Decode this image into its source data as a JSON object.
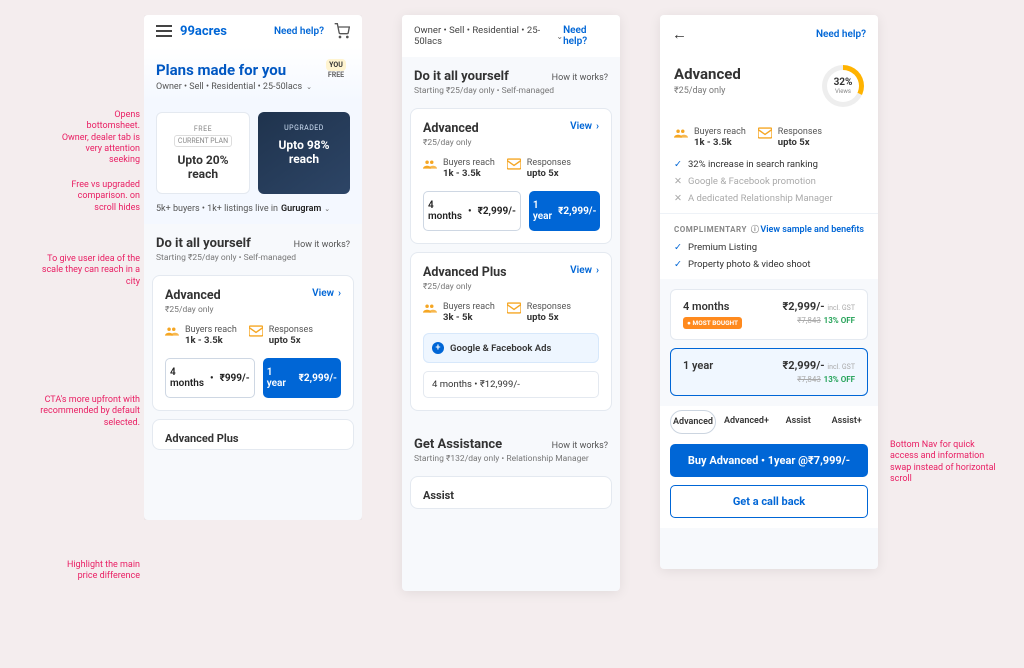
{
  "annotations": {
    "a1": "Opens bottomsheet.\nOwner, dealer tab is very attention seeking",
    "a2": "Free vs upgraded comparison.\non scroll hides",
    "a3": "To give user idea of the scale they can reach in a city",
    "a4": "CTA's more upfront with recommended by default selected.",
    "a5": "Highlight the main price difference",
    "a6": "Bottom Nav for quick access and information swap instead of horizontal scroll"
  },
  "common": {
    "needhelp": "Need help?",
    "how": "How it works?",
    "view": "View",
    "arrow": "›",
    "caret": "⌄"
  },
  "p1": {
    "brand": "99acres",
    "hero_title": "Plans made for you",
    "hero_sub": "Owner • Sell • Residential • 25-50lacs",
    "you": "YOU",
    "free": "FREE",
    "cmp_free_tag": "FREE",
    "cmp_free_cur": "CURRENT PLAN",
    "cmp_free_big": "Upto 20% reach",
    "cmp_upg_tag": "UPGRADED",
    "cmp_upg_big": "Upto 98% reach",
    "scale_a": "5k+ buyers • 1k+ listings live in",
    "scale_city": "Gurugram",
    "diy_title": "Do it all yourself",
    "diy_sub": "Starting ₹25/day only • Self-managed",
    "adv_name": "Advanced",
    "adv_rate": "₹25/day only",
    "m1_t": "Buyers reach",
    "m1_v": "1k - 3.5k",
    "m2_t": "Responses",
    "m2_v": "upto 5x",
    "p_out_dur": "4 months",
    "p_out_amt": "₹999/-",
    "p_sol_dur": "1 year",
    "p_sol_amt": "₹2,999/-",
    "next_card": "Advanced Plus"
  },
  "p2": {
    "breadcrumb": "Owner • Sell • Residential • 25-50lacs",
    "diy_title": "Do it all yourself",
    "diy_sub": "Starting ₹25/day only • Self-managed",
    "adv": {
      "name": "Advanced",
      "rate": "₹25/day only",
      "m1_t": "Buyers reach",
      "m1_v": "1k - 3.5k",
      "m2_t": "Responses",
      "m2_v": "upto 5x",
      "p_out_dur": "4 months",
      "p_out_amt": "₹2,999/-",
      "p_sol_dur": "1 year",
      "p_sol_amt": "₹2,999/-"
    },
    "advp": {
      "name": "Advanced Plus",
      "rate": "₹25/day only",
      "m1_t": "Buyers reach",
      "m1_v": "3k - 5k",
      "m2_t": "Responses",
      "m2_v": "upto 5x",
      "gads": "Google & Facebook Ads",
      "line": "4 months • ₹12,999/-"
    },
    "ga_title": "Get Assistance",
    "ga_sub": "Starting ₹132/day only • Relationship Manager",
    "assist": "Assist"
  },
  "p3": {
    "title": "Advanced",
    "rate": "₹25/day only",
    "pct": "32%",
    "pct_lbl": "Views",
    "m1_t": "Buyers reach",
    "m1_v": "1k - 3.5k",
    "m2_t": "Responses",
    "m2_v": "upto 5x",
    "f1": "32% increase in search ranking",
    "f2": "Google & Facebook  promotion",
    "f3": "A dedicated Relationship Manager",
    "comp": "COMPLIMENTARY",
    "benefits": "View sample and benefits",
    "c1": "Premium Listing",
    "c2": "Property photo & video shoot",
    "s1_dur": "4 months",
    "s1_most": "● MOST BOUGHT",
    "s1_pr": "₹2,999/-",
    "s1_incl": "incl. GST",
    "s1_old": "₹7,843",
    "s1_off": "13% OFF",
    "s2_dur": "1 year",
    "s2_pr": "₹2,999/-",
    "s2_incl": "incl. GST",
    "s2_old": "₹7,843",
    "s2_off": "13% OFF",
    "t1": "Advanced",
    "t2": "Advanced+",
    "t3": "Assist",
    "t4": "Assist+",
    "buy": "Buy Advanced • 1year @₹7,999/-",
    "call": "Get a call back"
  }
}
